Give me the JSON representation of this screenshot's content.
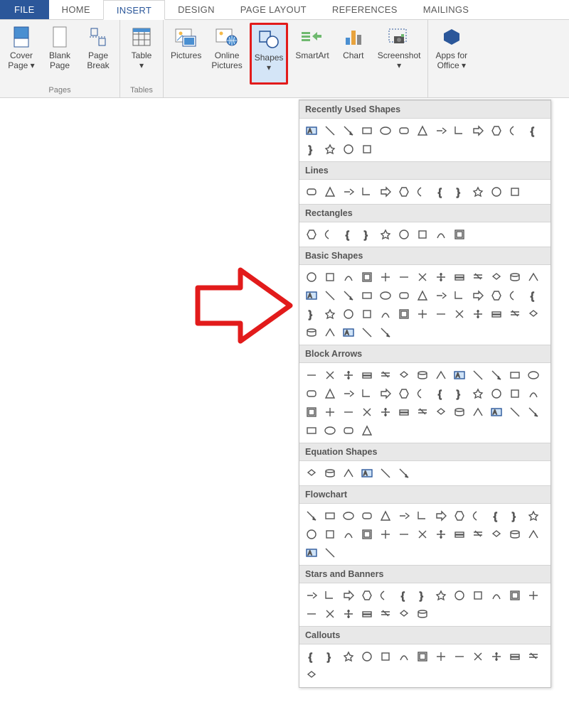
{
  "tabs": {
    "file": "FILE",
    "home": "HOME",
    "insert": "INSERT",
    "design": "DESIGN",
    "pagelayout": "PAGE LAYOUT",
    "references": "REFERENCES",
    "mailings": "MAILINGS"
  },
  "ribbon": {
    "groups": {
      "pages": {
        "label": "Pages",
        "buttons": {
          "cover": "Cover\nPage ▾",
          "blank": "Blank\nPage",
          "break": "Page\nBreak"
        }
      },
      "tables": {
        "label": "Tables",
        "buttons": {
          "table": "Table\n▾"
        }
      },
      "illustrations": {
        "buttons": {
          "pictures": "Pictures",
          "online": "Online\nPictures",
          "shapes": "Shapes\n▾",
          "smartart": "SmartArt",
          "chart": "Chart",
          "screenshot": "Screenshot\n▾"
        }
      },
      "apps": {
        "buttons": {
          "apps": "Apps for\nOffice ▾"
        }
      }
    }
  },
  "dropdown": {
    "sections": [
      {
        "title": "Recently Used Shapes",
        "count": 17
      },
      {
        "title": "Lines",
        "count": 12
      },
      {
        "title": "Rectangles",
        "count": 9
      },
      {
        "title": "Basic Shapes",
        "count": 44
      },
      {
        "title": "Block Arrows",
        "count": 43
      },
      {
        "title": "Equation Shapes",
        "count": 6
      },
      {
        "title": "Flowchart",
        "count": 28
      },
      {
        "title": "Stars and Banners",
        "count": 20
      },
      {
        "title": "Callouts",
        "count": 14
      }
    ]
  }
}
